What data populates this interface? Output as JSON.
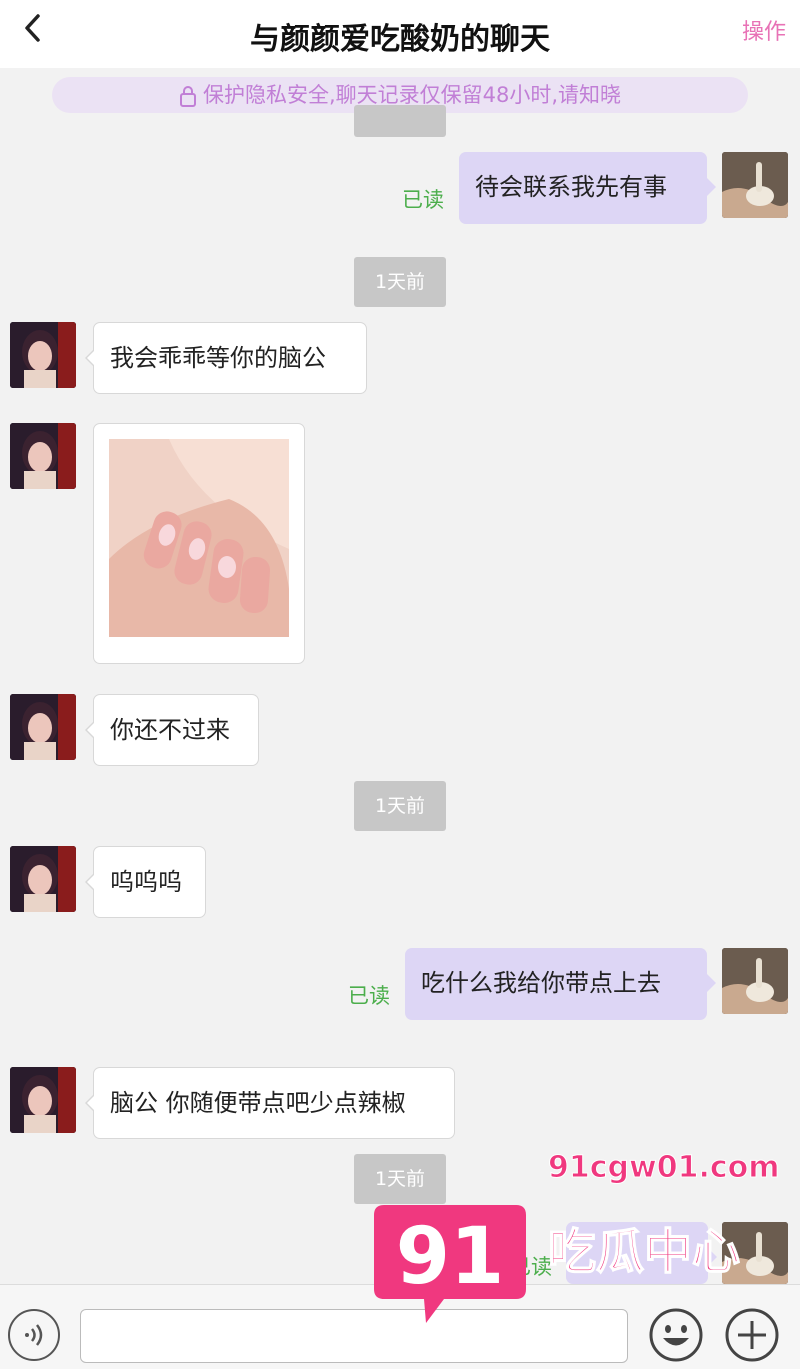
{
  "header": {
    "title": "与颜颜爱吃酸奶的聊天",
    "action_label": "操作"
  },
  "notice": {
    "text": "保护隐私安全,聊天记录仅保留48小时,请知晓"
  },
  "messages": [
    {
      "text": "待会联系我先有事",
      "read": "已读"
    },
    {
      "timestamp": "1天前"
    },
    {
      "text": "我会乖乖等你的脑公"
    },
    {
      "image": "hand-photo"
    },
    {
      "text": "你还不过来"
    },
    {
      "timestamp": "1天前"
    },
    {
      "text": "呜呜呜"
    },
    {
      "text": "吃什么我给你带点上去",
      "read": "已读"
    },
    {
      "text": "脑公 你随便带点吧少点辣椒"
    },
    {
      "timestamp": "1天前"
    },
    {
      "read": "已读"
    }
  ],
  "input": {
    "placeholder": ""
  },
  "watermark": {
    "url": "91cgw01.com",
    "number": "91",
    "name": "吃瓜中心"
  },
  "colors": {
    "accent": "#e872b6",
    "outgoing_bubble": "#ddd6f5",
    "read": "#4cae4c",
    "watermark": "#f0387f"
  }
}
